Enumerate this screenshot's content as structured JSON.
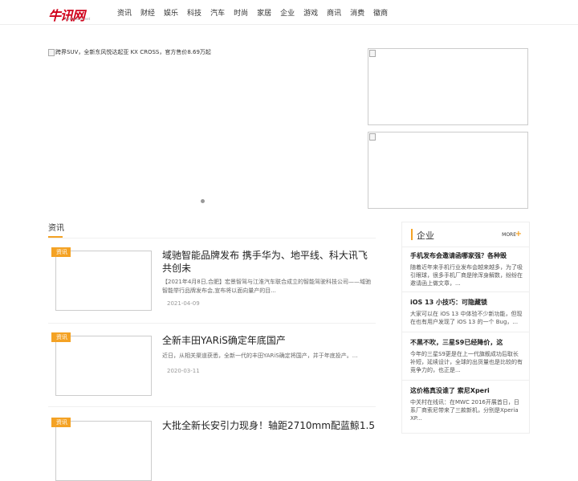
{
  "logo": {
    "text": "牛讯网",
    "sub": "www.niuxun.net"
  },
  "nav": [
    "资讯",
    "财经",
    "娱乐",
    "科技",
    "汽车",
    "时尚",
    "家居",
    "企业",
    "游戏",
    "商讯",
    "消费",
    "徽商"
  ],
  "banner": {
    "alt": "跨界SUV，全新东风悦达起亚 KX CROSS，官方售价8.69万起"
  },
  "section": {
    "title": "资讯"
  },
  "articles": [
    {
      "tag": "资讯",
      "title": "域驰智能品牌发布 携手华为、地平线、科大讯飞共创未",
      "desc": "【2021年4月8日,合肥】宏景智驾与江淮汽车联合成立的智能驾驶科技公司——域驰智能举行品牌发布会,宣布将以面向量产的目...",
      "date": "2021-04-09"
    },
    {
      "tag": "资讯",
      "title": "全新丰田YARiS确定年底国产",
      "desc": "近日，从相关渠道获悉，全新一代的丰田YARiS确定将国产，并于年底投产。...",
      "date": "2020-03-11"
    },
    {
      "tag": "资讯",
      "title": "大批全新长安引力现身！轴距2710mm配蓝鲸1.5",
      "desc": "",
      "date": ""
    }
  ],
  "panel": {
    "title": "企业",
    "more": "MORE",
    "items": [
      {
        "title": "手机发布会邀请函哪家强？各种毁",
        "desc": "随着近年来手机行业发布会越来越多，为了吸引眼球，很多手机厂商是除浑身解数，纷纷在邀请函上做文章，..."
      },
      {
        "title": "iOS 13 小技巧：可隐藏锁",
        "desc": "大家可以在 iOS 13 中体验不少新功能，但现在也有用户发现了 iOS 13 的一个 Bug，..."
      },
      {
        "title": "不黑不吹，三星S9已经降价，这",
        "desc": "今年的三星S9更是在上一代旗舰成功后取长补短，延续设计，全球的出货量也是比较的有竞争力的，也正是..."
      },
      {
        "title": "这价格真没谁了 索尼Xperi",
        "desc": "中关村在线讯：在MWC 2016开展首日，日系厂商索尼带来了三款新机，分别是Xperia XP..."
      }
    ]
  }
}
